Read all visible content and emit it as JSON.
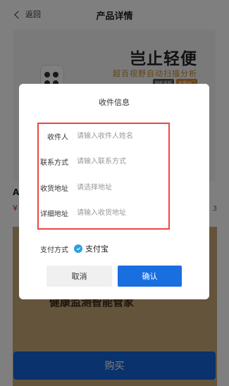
{
  "header": {
    "back_label": "返回",
    "title": "产品详情"
  },
  "banner": {
    "headline": "岂止轻便",
    "subline": "超百视野自动扫描分析",
    "tags": [
      "轻松采样",
      "无需出门"
    ]
  },
  "product": {
    "name_initial": "A",
    "price_symbol": "¥",
    "count_fragment": "3"
  },
  "lower_banner": {
    "text": "健康监测智能管家"
  },
  "buy_button": {
    "label": "购买"
  },
  "dialog": {
    "title": "收件信息",
    "fields": [
      {
        "label": "收件人",
        "placeholder": "请输入收件人姓名",
        "value": ""
      },
      {
        "label": "联系方式",
        "placeholder": "请输入联系方式",
        "value": ""
      },
      {
        "label": "收货地址",
        "placeholder": "请选择地址",
        "value": ""
      },
      {
        "label": "详细地址",
        "placeholder": "请输入收货地址",
        "value": ""
      }
    ],
    "payment": {
      "label": "支付方式",
      "selected": "支付宝",
      "icon": "check-circle-icon"
    },
    "cancel_label": "取消",
    "confirm_label": "确认"
  },
  "colors": {
    "primary": "#1a6fe0",
    "highlight_border": "#e44444",
    "radio": "#2ea0e0",
    "price": "#e02020"
  }
}
